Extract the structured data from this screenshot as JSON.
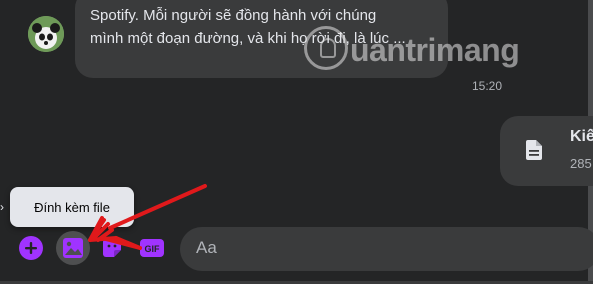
{
  "message": {
    "lines": [
      "Spotify. Mỗi người sẽ đồng hành với chúng",
      "mình một đoạn đường, và khi họ rời đi, là lúc ..."
    ],
    "timestamp": "15:20"
  },
  "watermark": {
    "text": "uantrimang"
  },
  "file_message": {
    "name": "Kiế",
    "size": "285"
  },
  "composer": {
    "tooltip": "Đính kèm file",
    "input_placeholder": "Aa",
    "gif_label": "GIF"
  },
  "colors": {
    "background": "#242526",
    "bubble": "#3a3b3c",
    "accent": "#a033ff",
    "annotation": "#e0191b",
    "tooltip_bg": "#e4e6eb"
  },
  "icons": {
    "avatar": "panda-avatar",
    "file": "document-icon",
    "plus": "plus-circle-icon",
    "attach": "image-attach-icon",
    "sticker": "sticker-icon",
    "gif": "gif-icon",
    "arrow": "red-arrow-annotation"
  }
}
